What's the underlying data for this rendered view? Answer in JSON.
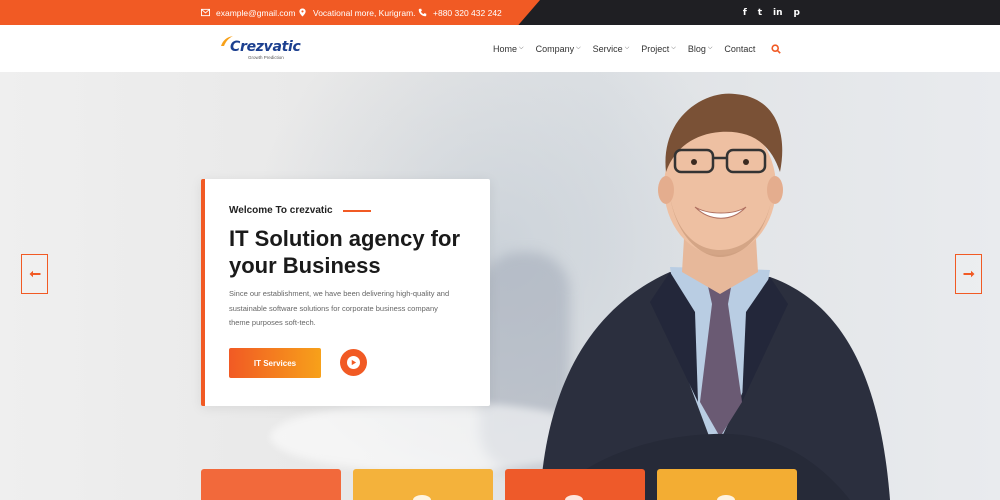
{
  "topbar": {
    "email": "example@gmail.com",
    "address": "Vocational more, Kurigram.",
    "phone": "+880 320 432 242",
    "socials": [
      {
        "icon": "facebook-icon",
        "glyph": "f"
      },
      {
        "icon": "twitter-icon",
        "glyph": "t"
      },
      {
        "icon": "linkedin-icon",
        "glyph": "in"
      },
      {
        "icon": "pinterest-icon",
        "glyph": "p"
      }
    ]
  },
  "header": {
    "logo_text": "Crezvatic",
    "logo_tagline": "Growth Prediction",
    "nav": [
      {
        "label": "Home",
        "dropdown": true
      },
      {
        "label": "Company",
        "dropdown": true
      },
      {
        "label": "Service",
        "dropdown": true
      },
      {
        "label": "Project",
        "dropdown": true
      },
      {
        "label": "Blog",
        "dropdown": true
      },
      {
        "label": "Contact",
        "dropdown": false
      }
    ]
  },
  "hero": {
    "kicker": "Welcome To crezvatic",
    "headline": "IT Solution agency for your Business",
    "description": "Since our establishment, we have been delivering high-quality and sustainable software solutions for corporate business company theme purposes soft-tech.",
    "cta_label": "IT Services"
  },
  "colors": {
    "accent": "#f15a24",
    "accent_2": "#f7a11a",
    "dark": "#1f1f23",
    "logo_blue": "#1b3f8f"
  }
}
